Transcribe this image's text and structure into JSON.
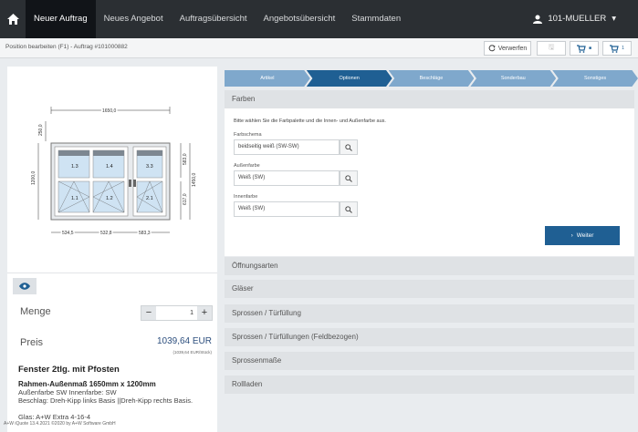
{
  "nav": {
    "items": [
      "Neuer Auftrag",
      "Neues Angebot",
      "Auftragsübersicht",
      "Angebotsübersicht",
      "Stammdaten"
    ],
    "user": "101-MUELLER"
  },
  "toolbar": {
    "breadcrumb": "Position bearbeiten (F1) - Auftrag #101000882",
    "discard_label": "Verwerfen",
    "cart_count_1": "1"
  },
  "drawing": {
    "width_total": "1650,0",
    "width_parts": [
      "534,5",
      "532,8",
      "583,3"
    ],
    "height_total": "1200,0",
    "height_top": "250,0",
    "height_right": [
      "583,0",
      "617,0"
    ],
    "height_right_total": "1450,0",
    "fields": [
      "1.3",
      "1.4",
      "3.3",
      "1.1",
      "1.2",
      "2.1"
    ]
  },
  "left": {
    "menge_label": "Menge",
    "menge_value": "1",
    "preis_label": "Preis",
    "preis_value": "1039,64 EUR",
    "preis_sub": "(1039,64 EUR/Stück)",
    "product_title": "Fenster 2tlg. mit Pfosten",
    "details": [
      "Rahmen-Außenmaß 1650mm x 1200mm",
      "Außenfarbe SW Innenfarbe: SW",
      "Beschlag: Dreh-Kipp links Basis ||Dreh-Kipp rechts Basis.",
      "Glas: A+W Extra 4-16-4"
    ],
    "footer": "A+W iQuote 13.4.2021 ©2020 by A+W Software GmbH"
  },
  "steps": [
    "Artikel",
    "Optionen",
    "Beschläge",
    "Sonderbau",
    "Sonstiges"
  ],
  "farben": {
    "title": "Farben",
    "hint": "Bitte wählen Sie die Farbpalette und die Innen- und Außenfarbe aus.",
    "fields": [
      {
        "label": "Farbschema",
        "value": "beidseitig weiß (SW-SW)"
      },
      {
        "label": "Außenfarbe",
        "value": "Weiß (SW)"
      },
      {
        "label": "Innenfarbe",
        "value": "Weiß (SW)"
      }
    ],
    "weiter": "Weiter"
  },
  "accordion": [
    "Öffnungsarten",
    "Gläser",
    "Sprossen / Türfüllung",
    "Sprossen / Türfüllungen (Feldbezogen)",
    "Sprossenmaße",
    "Rollladen"
  ],
  "colors": {
    "nav_bg": "#2b2f33",
    "accent": "#1f5f93",
    "step": "#7fa8cc"
  }
}
